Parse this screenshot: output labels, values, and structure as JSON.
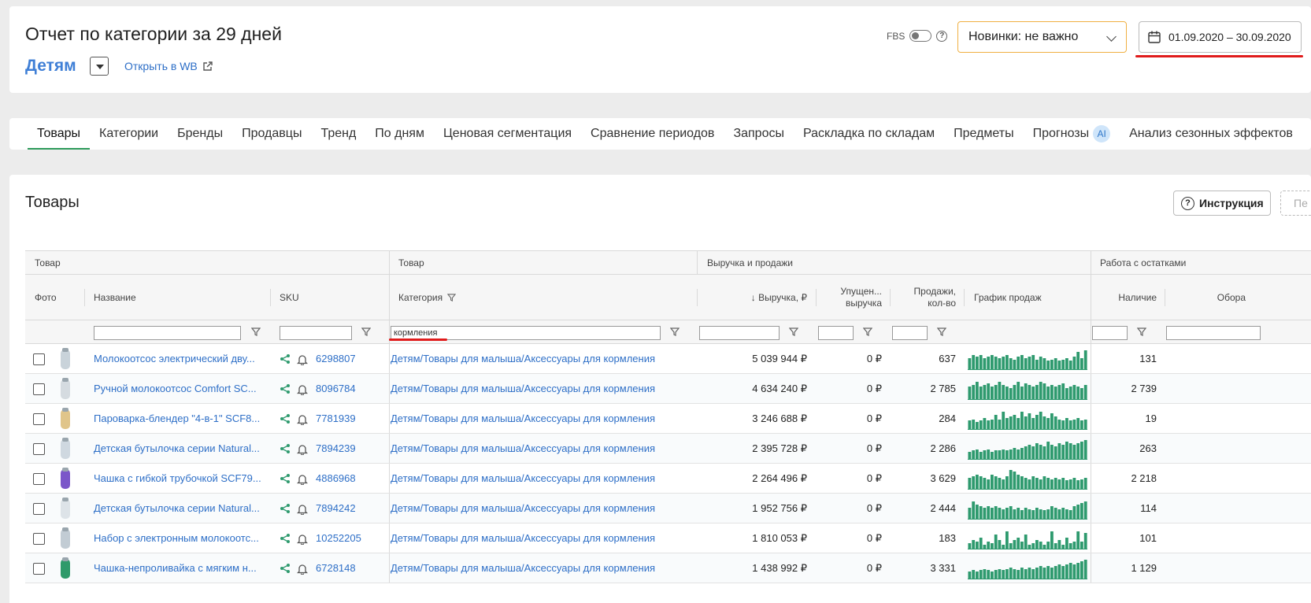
{
  "header": {
    "title": "Отчет по категории за 29 дней",
    "category": "Детям",
    "open_wb": "Открыть в WB",
    "fbs_label": "FBS",
    "novinki": "Новинки: не важно",
    "date_range": "01.09.2020 – 30.09.2020"
  },
  "tabs": [
    {
      "label": "Товары"
    },
    {
      "label": "Категории"
    },
    {
      "label": "Бренды"
    },
    {
      "label": "Продавцы"
    },
    {
      "label": "Тренд"
    },
    {
      "label": "По дням"
    },
    {
      "label": "Ценовая сегментация"
    },
    {
      "label": "Сравнение периодов"
    },
    {
      "label": "Запросы"
    },
    {
      "label": "Раскладка по складам"
    },
    {
      "label": "Предметы"
    },
    {
      "label": "Прогнозы",
      "badge": "AI"
    },
    {
      "label": "Анализ сезонных эффектов"
    }
  ],
  "section": {
    "title": "Товары",
    "instr_btn": "Инструкция",
    "cut_btn": "Пе"
  },
  "table": {
    "groups": {
      "tovar1": "Товар",
      "tovar2": "Товар",
      "revenue": "Выручка и продажи",
      "stock": "Работа с остатками"
    },
    "columns": {
      "photo": "Фото",
      "name": "Название",
      "sku": "SKU",
      "category": "Категория",
      "revenue": "↓ Выручка, ₽",
      "lost_1": "Упущен...",
      "lost_2": "выручка",
      "sales_1": "Продажи,",
      "sales_2": "кол-во",
      "chart": "График продаж",
      "stock": "Наличие",
      "turnover": "Обора"
    },
    "filter_category": "кормления",
    "rows": [
      {
        "name": "Молокоотсос электрический дву...",
        "sku": "6298807",
        "category": "Детям/Товары для малыша/Аксессуары для кормления",
        "revenue": "5 039 944 ₽",
        "lost": "0 ₽",
        "sales": "637",
        "stock": "131",
        "bars": [
          8,
          10,
          9,
          10,
          8,
          9,
          10,
          9,
          8,
          9,
          10,
          8,
          7,
          9,
          10,
          8,
          9,
          10,
          7,
          9,
          8,
          6,
          7,
          8,
          6,
          7,
          8,
          6,
          9,
          12,
          8,
          13
        ]
      },
      {
        "name": "Ручной молокоотсос Comfort SC...",
        "sku": "8096784",
        "category": "Детям/Товары для малыша/Аксессуары для кормления",
        "revenue": "4 634 240 ₽",
        "lost": "0 ₽",
        "sales": "2 785",
        "stock": "2 739",
        "bars": [
          9,
          10,
          12,
          9,
          10,
          11,
          9,
          10,
          12,
          10,
          9,
          8,
          10,
          12,
          9,
          11,
          10,
          9,
          10,
          12,
          11,
          9,
          10,
          9,
          10,
          11,
          8,
          9,
          10,
          9,
          8,
          10
        ]
      },
      {
        "name": "Пароварка-блендер \"4-в-1\" SCF8...",
        "sku": "7781939",
        "category": "Детям/Товары для малыша/Аксессуары для кормления",
        "revenue": "3 246 688 ₽",
        "lost": "0 ₽",
        "sales": "284",
        "stock": "19",
        "bars": [
          6,
          7,
          5,
          6,
          8,
          6,
          7,
          10,
          7,
          12,
          8,
          9,
          10,
          8,
          12,
          9,
          11,
          8,
          10,
          12,
          9,
          8,
          11,
          9,
          7,
          6,
          8,
          6,
          7,
          8,
          6,
          7
        ]
      },
      {
        "name": "Детская бутылочка серии Natural...",
        "sku": "7894239",
        "category": "Детям/Товары для малыша/Аксессуары для кормления",
        "revenue": "2 395 728 ₽",
        "lost": "0 ₽",
        "sales": "2 286",
        "stock": "263",
        "bars": [
          5,
          6,
          7,
          5,
          6,
          7,
          5,
          6,
          6,
          7,
          6,
          7,
          8,
          7,
          8,
          9,
          10,
          9,
          11,
          10,
          9,
          12,
          10,
          9,
          11,
          10,
          12,
          11,
          10,
          11,
          12,
          13
        ]
      },
      {
        "name": "Чашка с гибкой трубочкой SCF79...",
        "sku": "4886968",
        "category": "Детям/Товары для малыша/Аксессуары для кормления",
        "revenue": "2 264 496 ₽",
        "lost": "0 ₽",
        "sales": "3 629",
        "stock": "2 218",
        "bars": [
          8,
          9,
          10,
          9,
          8,
          7,
          10,
          9,
          8,
          7,
          9,
          13,
          12,
          10,
          9,
          8,
          7,
          9,
          8,
          7,
          9,
          8,
          7,
          8,
          7,
          8,
          6,
          7,
          8,
          6,
          7,
          8
        ]
      },
      {
        "name": "Детская бутылочка серии Natural...",
        "sku": "7894242",
        "category": "Детям/Товары для малыша/Аксессуары для кормления",
        "revenue": "1 952 756 ₽",
        "lost": "0 ₽",
        "sales": "2 444",
        "stock": "114",
        "bars": [
          8,
          12,
          10,
          9,
          8,
          9,
          8,
          9,
          8,
          7,
          8,
          9,
          7,
          8,
          6,
          8,
          7,
          6,
          8,
          7,
          6,
          7,
          9,
          8,
          7,
          8,
          7,
          6,
          9,
          10,
          11,
          12
        ]
      },
      {
        "name": "Набор с электронным молокоотс...",
        "sku": "10252205",
        "category": "Детям/Товары для малыша/Аксессуары для кормления",
        "revenue": "1 810 053 ₽",
        "lost": "0 ₽",
        "sales": "183",
        "stock": "101",
        "bars": [
          4,
          6,
          5,
          8,
          3,
          5,
          4,
          10,
          6,
          3,
          12,
          4,
          6,
          8,
          5,
          10,
          3,
          4,
          6,
          5,
          3,
          5,
          12,
          4,
          6,
          3,
          8,
          4,
          5,
          12,
          5,
          11
        ]
      },
      {
        "name": "Чашка-непроливайка с мягким н...",
        "sku": "6728148",
        "category": "Детям/Товары для малыша/Аксессуары для кормления",
        "revenue": "1 438 992 ₽",
        "lost": "0 ₽",
        "sales": "3 331",
        "stock": "1 129",
        "bars": [
          5,
          6,
          5,
          6,
          7,
          6,
          5,
          6,
          7,
          6,
          7,
          8,
          7,
          6,
          8,
          7,
          8,
          7,
          8,
          9,
          8,
          9,
          8,
          9,
          10,
          9,
          10,
          11,
          10,
          11,
          12,
          13
        ]
      }
    ]
  },
  "colors": {
    "accent_green": "#2d9a5a",
    "link_blue": "#2e6fc7",
    "spark_green": "#2e9a6e",
    "highlight_red": "#e01b1b",
    "select_border": "#f0b042"
  }
}
